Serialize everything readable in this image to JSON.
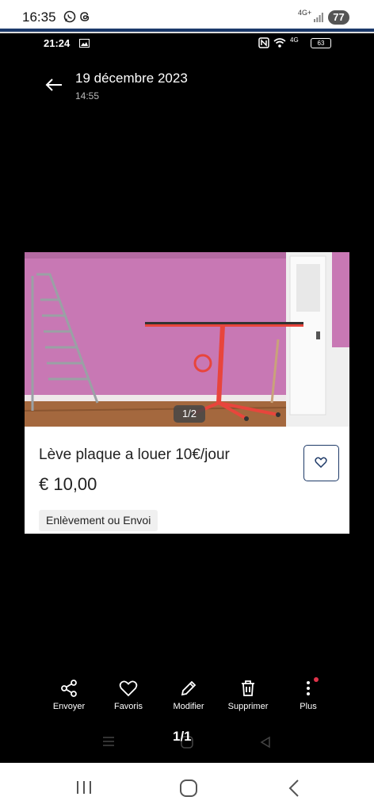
{
  "outer_status": {
    "time": "16:35",
    "network": "4G+",
    "battery": "77"
  },
  "inner_status": {
    "time": "21:24",
    "network": "4G",
    "battery": "63"
  },
  "header": {
    "date": "19 décembre 2023",
    "time": "14:55"
  },
  "listing": {
    "image_counter": "1/2",
    "title": "Lève plaque a louer 10€/jour",
    "price": "€ 10,00",
    "delivery": "Enlèvement ou Envoi"
  },
  "actions": [
    {
      "label": "Envoyer",
      "icon": "share-icon"
    },
    {
      "label": "Favoris",
      "icon": "heart-icon"
    },
    {
      "label": "Modifier",
      "icon": "pencil-icon"
    },
    {
      "label": "Supprimer",
      "icon": "trash-icon"
    },
    {
      "label": "Plus",
      "icon": "more-vertical-icon"
    }
  ],
  "pager": "1/1",
  "colors": {
    "accent_border": "#1e3a68",
    "notification_dot": "#e0334a",
    "wall": "#c878b4",
    "lift": "#e8453c"
  }
}
